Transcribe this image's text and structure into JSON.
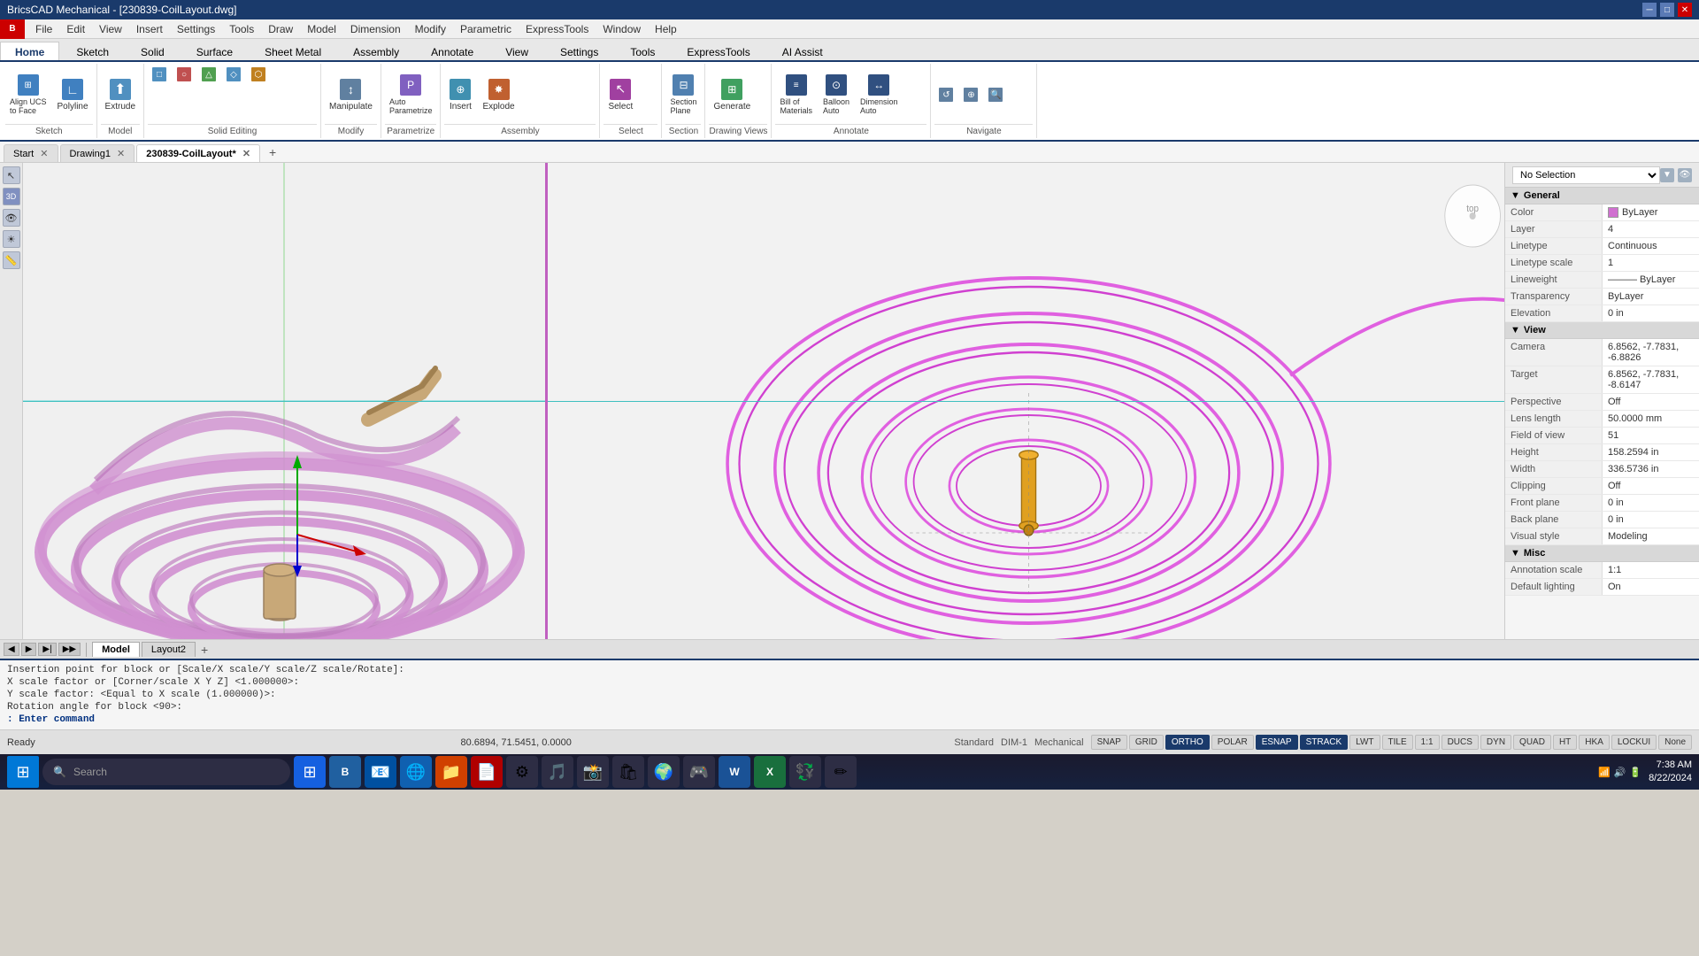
{
  "titlebar": {
    "title": "BricsCAD Mechanical - [230839-CoilLayout.dwg]",
    "minimize": "─",
    "maximize": "□",
    "close": "✕"
  },
  "menubar": {
    "logo": "B",
    "items": [
      "File",
      "Edit",
      "View",
      "Insert",
      "Settings",
      "Tools",
      "Draw",
      "Model",
      "Dimension",
      "Modify",
      "Parametric",
      "ExpressTools",
      "Window",
      "Help"
    ]
  },
  "ribbon": {
    "active_tab": "Home",
    "tabs": [
      "Home",
      "Sketch",
      "Solid",
      "Surface",
      "Sheet Metal",
      "Assembly",
      "Annotate",
      "View",
      "Settings",
      "Tools",
      "ExpressTools",
      "AI Assist"
    ],
    "groups": {
      "sketch": {
        "label": "Sketch",
        "buttons": [
          "Align UCS to Face",
          "Polyline"
        ]
      },
      "model": {
        "label": "Model",
        "buttons": [
          "Extrude"
        ]
      },
      "solid_editing": {
        "label": "Solid Editing",
        "buttons": []
      },
      "modify": {
        "label": "Modify",
        "buttons": [
          "Manipulate"
        ]
      },
      "parametrize": {
        "label": "Parametrize",
        "buttons": [
          "Auto Parametrize"
        ]
      },
      "assembly": {
        "label": "Assembly",
        "buttons": [
          "Insert",
          "Explode"
        ]
      },
      "select": {
        "label": "Select",
        "buttons": []
      },
      "section": {
        "label": "Section",
        "buttons": [
          "Section Plane"
        ]
      },
      "drawing_views": {
        "label": "Drawing Views",
        "buttons": [
          "Generate"
        ]
      },
      "annotate": {
        "label": "Annotate",
        "buttons": [
          "Bill of Materials",
          "Balloon Auto",
          "Dimension Auto"
        ]
      },
      "navigate": {
        "label": "Navigate",
        "buttons": []
      }
    }
  },
  "doc_tabs": [
    {
      "id": "start",
      "label": "Start",
      "closeable": false
    },
    {
      "id": "drawing1",
      "label": "Drawing1",
      "closeable": true
    },
    {
      "id": "coillayout",
      "label": "230839-CoilLayout*",
      "closeable": true,
      "active": true
    }
  ],
  "properties_panel": {
    "title": "No Selection",
    "sections": {
      "general": {
        "label": "General",
        "expanded": true,
        "rows": [
          {
            "name": "Color",
            "value": "ByLayer",
            "type": "color",
            "color": "#d070d0"
          },
          {
            "name": "Layer",
            "value": "4"
          },
          {
            "name": "Linetype",
            "value": "Continuous"
          },
          {
            "name": "Linetype scale",
            "value": "1"
          },
          {
            "name": "Lineweight",
            "value": "ByLayer"
          },
          {
            "name": "Transparency",
            "value": "ByLayer"
          },
          {
            "name": "Elevation",
            "value": "0 in"
          }
        ]
      },
      "view": {
        "label": "View",
        "expanded": true,
        "rows": [
          {
            "name": "Camera",
            "value": "6.8562, -7.7831, -6.8826"
          },
          {
            "name": "Target",
            "value": "6.8562, -7.7831, -8.6147"
          },
          {
            "name": "Perspective",
            "value": "Off"
          },
          {
            "name": "Lens length",
            "value": "50.0000 mm"
          },
          {
            "name": "Field of view",
            "value": "51"
          },
          {
            "name": "Height",
            "value": "158.2594 in"
          },
          {
            "name": "Width",
            "value": "336.5736 in"
          },
          {
            "name": "Clipping",
            "value": "Off"
          },
          {
            "name": "Front plane",
            "value": "0 in"
          },
          {
            "name": "Back plane",
            "value": "0 in"
          },
          {
            "name": "Visual style",
            "value": "Modeling"
          }
        ]
      },
      "misc": {
        "label": "Misc",
        "expanded": true,
        "rows": [
          {
            "name": "Annotation scale",
            "value": "1:1"
          },
          {
            "name": "Default lighting",
            "value": "On"
          }
        ]
      }
    }
  },
  "command_lines": [
    "Insertion point for block or [Scale/X scale/Y scale/Z scale/Rotate]:",
    "X scale factor or [Corner/scale X Y Z] <1.000000>:",
    "Y scale factor: <Equal to X scale (1.000000)>:",
    "Rotation angle for block <90>:"
  ],
  "command_prompt": ": Enter command",
  "statusbar": {
    "ready": "Ready",
    "coords": "80.6894, 71.5451, 0.0000",
    "standard": "Standard",
    "dim1": "DIM-1",
    "mechanical": "Mechanical",
    "toggles": [
      {
        "label": "SNAP",
        "active": false
      },
      {
        "label": "GRID",
        "active": false
      },
      {
        "label": "ORTHO",
        "active": true
      },
      {
        "label": "POLAR",
        "active": false
      },
      {
        "label": "ESNAP",
        "active": true
      },
      {
        "label": "STRACK",
        "active": true
      },
      {
        "label": "LWT",
        "active": false
      },
      {
        "label": "TILE",
        "active": false
      },
      {
        "label": "1:1",
        "active": false
      },
      {
        "label": "DUCS",
        "active": false
      },
      {
        "label": "DYN",
        "active": false
      },
      {
        "label": "QUAD",
        "active": false
      },
      {
        "label": "HT",
        "active": false
      },
      {
        "label": "HKA",
        "active": false
      },
      {
        "label": "LOCKUI",
        "active": false
      },
      {
        "label": "None",
        "active": false
      }
    ]
  },
  "taskbar": {
    "search_placeholder": "Search",
    "time": "7:38 AM",
    "date": "8/22/2024",
    "apps": [
      "⊞",
      "🔍",
      "📁",
      "📧",
      "🗂",
      "📄",
      "🎵",
      "📸",
      "🌐",
      "🎮",
      "💻"
    ]
  },
  "model_tabs": [
    {
      "label": "Model",
      "active": true
    },
    {
      "label": "Layout2"
    }
  ]
}
